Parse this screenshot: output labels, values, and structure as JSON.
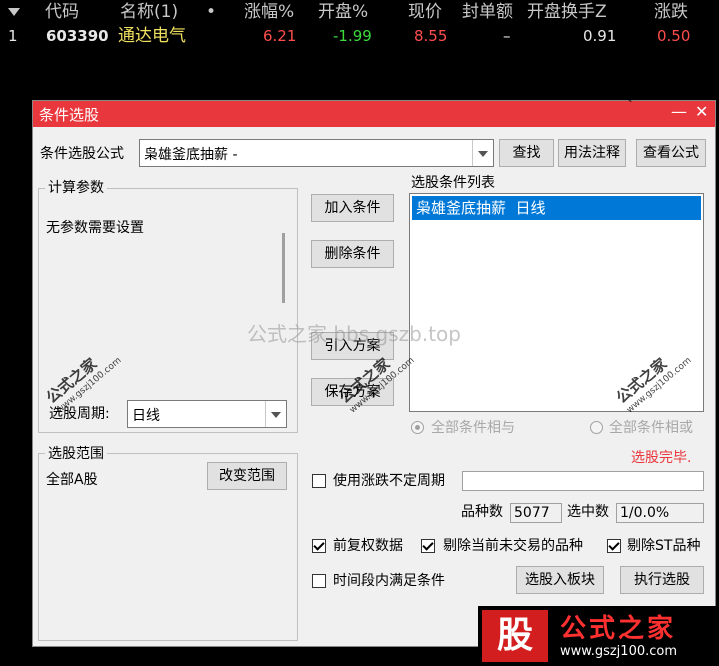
{
  "quote": {
    "columns": [
      "代码",
      "名称(1)",
      "•",
      "涨幅%",
      "开盘%",
      "现价",
      "封单额",
      "开盘换手Z",
      "涨跌"
    ],
    "row": {
      "index": "1",
      "code": "603390",
      "name": "通达电气",
      "change_pct": "6.21",
      "open_pct": "-1.99",
      "price": "8.55",
      "seal_amount": "–",
      "open_turnover": "0.91",
      "change": "0.50"
    }
  },
  "dialog": {
    "title": "条件选股",
    "formula_label": "条件选股公式",
    "formula_value": "枭雄釜底抽薪 -",
    "find_button": "查找",
    "usage_button": "用法注释",
    "view_formula_button": "查看公式",
    "params_group": "计算参数",
    "params_text": "无参数需要设置",
    "period_label": "选股周期:",
    "period_value": "日线",
    "add_condition": "加入条件",
    "delete_condition": "删除条件",
    "import_plan": "引入方案",
    "save_plan": "保存方案",
    "condition_list_label": "选股条件列表",
    "conditions": [
      "枭雄釜底抽薪  日线"
    ],
    "radio_and": "全部条件相与",
    "radio_or": "全部条件相或",
    "status": "选股完毕.",
    "range_group": "选股范围",
    "range_value": "全部A股",
    "change_range": "改变范围",
    "use_period": "使用涨跌不定周期",
    "count_label": "品种数",
    "count_value": "5077",
    "selected_label": "选中数",
    "selected_value": "1/0.0%",
    "fq_label": "前复权数据",
    "exclude_untraded": "剔除当前未交易的品种",
    "exclude_st": "剔除ST品种",
    "time_condition": "时间段内满足条件",
    "to_block": "选股入板块",
    "execute": "执行选股"
  },
  "watermarks": {
    "center": "公式之家 bbs.gszb.top",
    "stamp": "公式之家",
    "stamp_url": "www.gszj100.com",
    "banner_logo": "股",
    "banner_title": "公式之家",
    "banner_url": "www.gszj100.com"
  },
  "colors": {
    "titlebar": "#e8373d",
    "up": "#ff4d4d",
    "down": "#3cdc3c",
    "selection": "#0078d7",
    "status": "#e8373d"
  }
}
